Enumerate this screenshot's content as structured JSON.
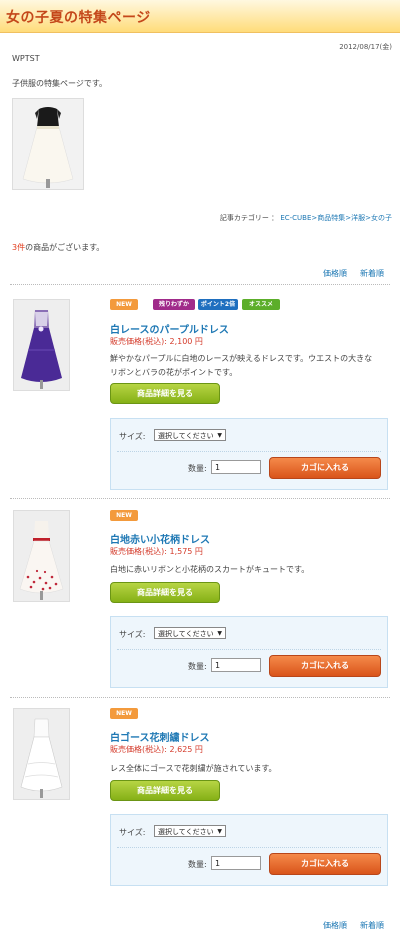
{
  "page": {
    "title": "女の子夏の特集ページ",
    "date": "2012/08/17(金)",
    "author": "WPTST",
    "intro": "子供服の特集ページです。"
  },
  "category": {
    "label": "記事カテゴリー",
    "path": "EC-CUBE>商品特集>洋服>女の子"
  },
  "listing": {
    "count_num": "3件",
    "count_text": "の商品がございます。",
    "sort_price": "価格順",
    "sort_new": "新着順"
  },
  "cart": {
    "size_label": "サイズ:",
    "size_select": "選択してください",
    "qty_label": "数量:",
    "qty_value": "1",
    "cart_button": "カゴに入れる",
    "detail_button": "商品詳細を見る"
  },
  "products": [
    {
      "badges": [
        "NEW",
        "残りわずか",
        "ポイント2倍",
        "オススメ"
      ],
      "name": "白レースのパープルドレス",
      "price_label": "販売価格(税込):",
      "price_value": "2,100 円",
      "desc_line1": "鮮やかなパープルに白地のレースが映えるドレスです。ウエストの大きな",
      "desc_line2": "リボンとバラの花がポイントです。"
    },
    {
      "badges": [
        "NEW"
      ],
      "name": "白地赤い小花柄ドレス",
      "price_label": "販売価格(税込):",
      "price_value": "1,575 円",
      "desc_line1": "白地に赤いリボンと小花柄のスカートがキュートです。"
    },
    {
      "badges": [
        "NEW"
      ],
      "name": "白ゴース花刺繍ドレス",
      "price_label": "販売価格(税込):",
      "price_value": "2,625 円",
      "desc_line1": "レス全体にゴースで花刺繍が施されています。"
    }
  ],
  "colors": {
    "title": "#c4471a",
    "link": "#1e78b4",
    "price": "#d43a2a",
    "accent_red": "#e03b1c",
    "green_button": "#85b016",
    "orange_button": "#d9541a"
  }
}
